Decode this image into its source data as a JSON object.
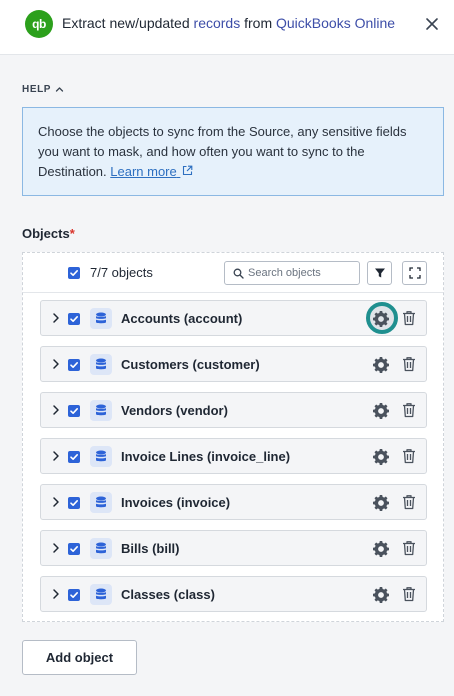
{
  "header": {
    "logo_text": "qb",
    "title_prefix": "Extract new/updated ",
    "title_records": "records",
    "title_middle": " from ",
    "title_source": "QuickBooks Online"
  },
  "help": {
    "toggle_label": "HELP",
    "text": "Choose the objects to sync from the Source, any sensitive fields you want to mask, and how often you want to sync to the Destination. ",
    "learn_more": "Learn more"
  },
  "objects": {
    "label": "Objects",
    "required_mark": "*",
    "count_label": "7/7 objects",
    "search_placeholder": "Search objects",
    "add_button": "Add object",
    "items": [
      {
        "name": "Accounts (account)",
        "checked": true
      },
      {
        "name": "Customers (customer)",
        "checked": true
      },
      {
        "name": "Vendors (vendor)",
        "checked": true
      },
      {
        "name": "Invoice Lines (invoice_line)",
        "checked": true
      },
      {
        "name": "Invoices (invoice)",
        "checked": true
      },
      {
        "name": "Bills (bill)",
        "checked": true
      },
      {
        "name": "Classes (class)",
        "checked": true
      }
    ]
  },
  "colors": {
    "accent": "#2d63d8",
    "quickbooks_green": "#2ca01c",
    "highlight_ring": "#1f8f8f",
    "help_bg": "#e6f1fb"
  },
  "icons": [
    "quickbooks-logo",
    "close-icon",
    "chevron-up-icon",
    "external-link-icon",
    "search-icon",
    "filter-icon",
    "expand-icon",
    "chevron-right-icon",
    "database-icon",
    "gear-icon",
    "trash-icon",
    "checkbox-checked-icon"
  ]
}
